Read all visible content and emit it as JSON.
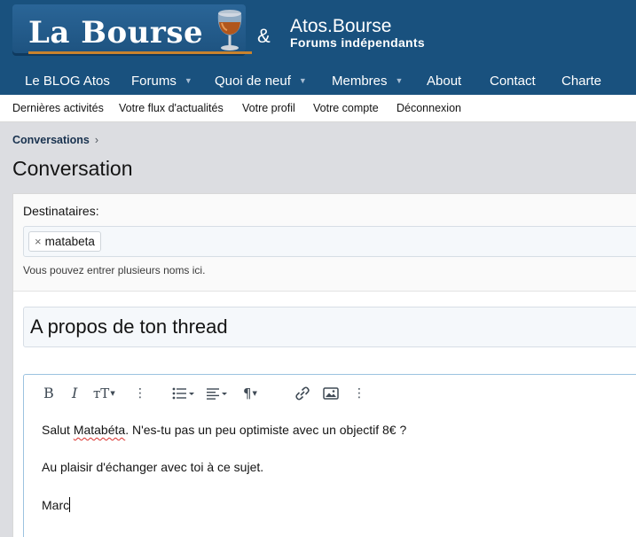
{
  "header": {
    "logo_text": "La Bourse",
    "ampersand": "&",
    "site_title": "Atos.Bourse",
    "site_subtitle": "Forums indépendants"
  },
  "nav": {
    "items": [
      {
        "label": "Le BLOG Atos",
        "dropdown": false
      },
      {
        "label": "Forums",
        "dropdown": true
      },
      {
        "label": "Quoi de neuf",
        "dropdown": true
      },
      {
        "label": "Membres",
        "dropdown": true
      },
      {
        "label": "About",
        "dropdown": false
      },
      {
        "label": "Contact",
        "dropdown": false
      },
      {
        "label": "Charte",
        "dropdown": false
      }
    ]
  },
  "subnav": {
    "items": [
      {
        "label": "Dernières activités"
      },
      {
        "label": "Votre flux d'actualités"
      },
      {
        "label": "Votre profil"
      },
      {
        "label": "Votre compte"
      },
      {
        "label": "Déconnexion"
      }
    ]
  },
  "breadcrumb": {
    "item": "Conversations",
    "separator": "›"
  },
  "page": {
    "title": "Conversation"
  },
  "form": {
    "recipients_label": "Destinataires:",
    "recipient_token": "matabeta",
    "recipient_remove": "×",
    "recipients_help": "Vous pouvez entrer plusieurs noms ici.",
    "title_value": "A propos de ton thread"
  },
  "editor": {
    "toolbar": [
      "bold-icon",
      "italic-icon",
      "font-size-icon",
      "more-vertical-icon",
      "list-icon",
      "align-icon",
      "paragraph-icon",
      "link-icon",
      "image-icon",
      "more-vertical-icon"
    ],
    "paragraph1_start": "Salut ",
    "paragraph1_misspelled": "Matabéta",
    "paragraph1_end": ". N'es-tu pas un peu optimiste avec un objectif 8€ ?",
    "paragraph2": "Au plaisir d'échanger avec toi à ce sujet.",
    "paragraph3": "Marc"
  },
  "colors": {
    "header_bg": "#19517e",
    "page_bg": "#dcdde1",
    "accent": "#c9832d"
  }
}
